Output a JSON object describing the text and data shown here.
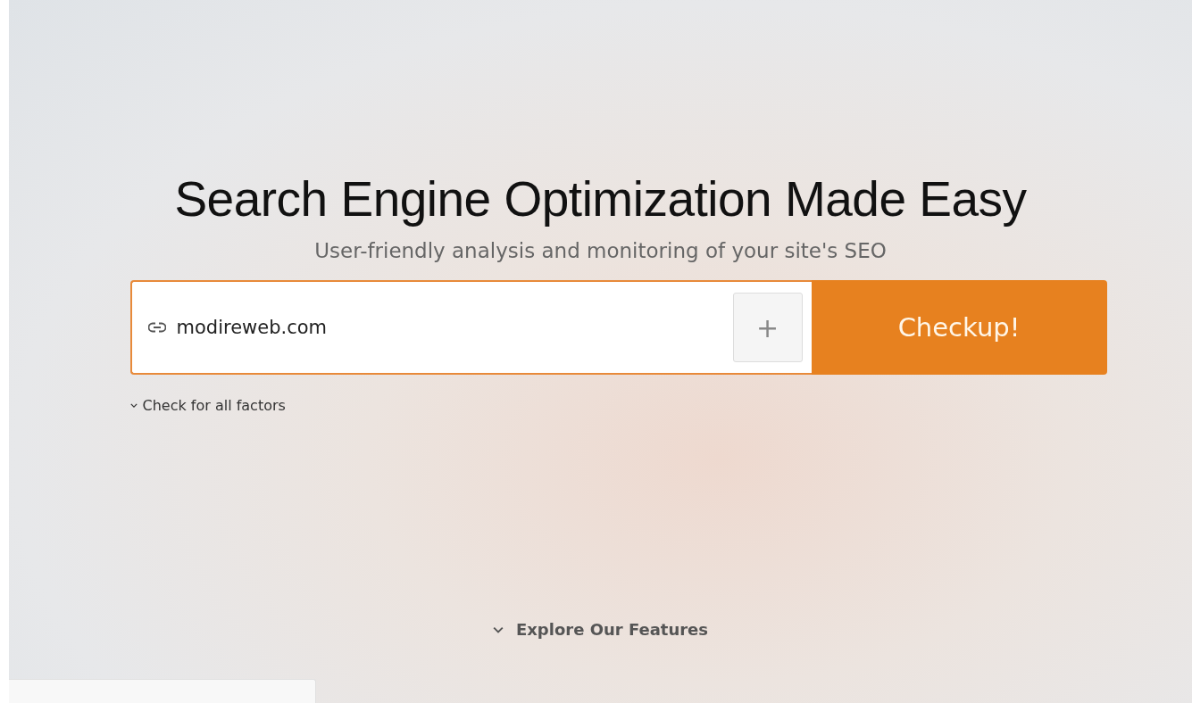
{
  "hero": {
    "title": "Search Engine Optimization Made Easy",
    "subtitle": "User-friendly analysis and monitoring of your site's SEO"
  },
  "search": {
    "value": "modireweb.com",
    "add_button": "+",
    "submit_button": "Checkup!"
  },
  "options_link": "Check for all factors",
  "explore_link": "Explore Our Features"
}
